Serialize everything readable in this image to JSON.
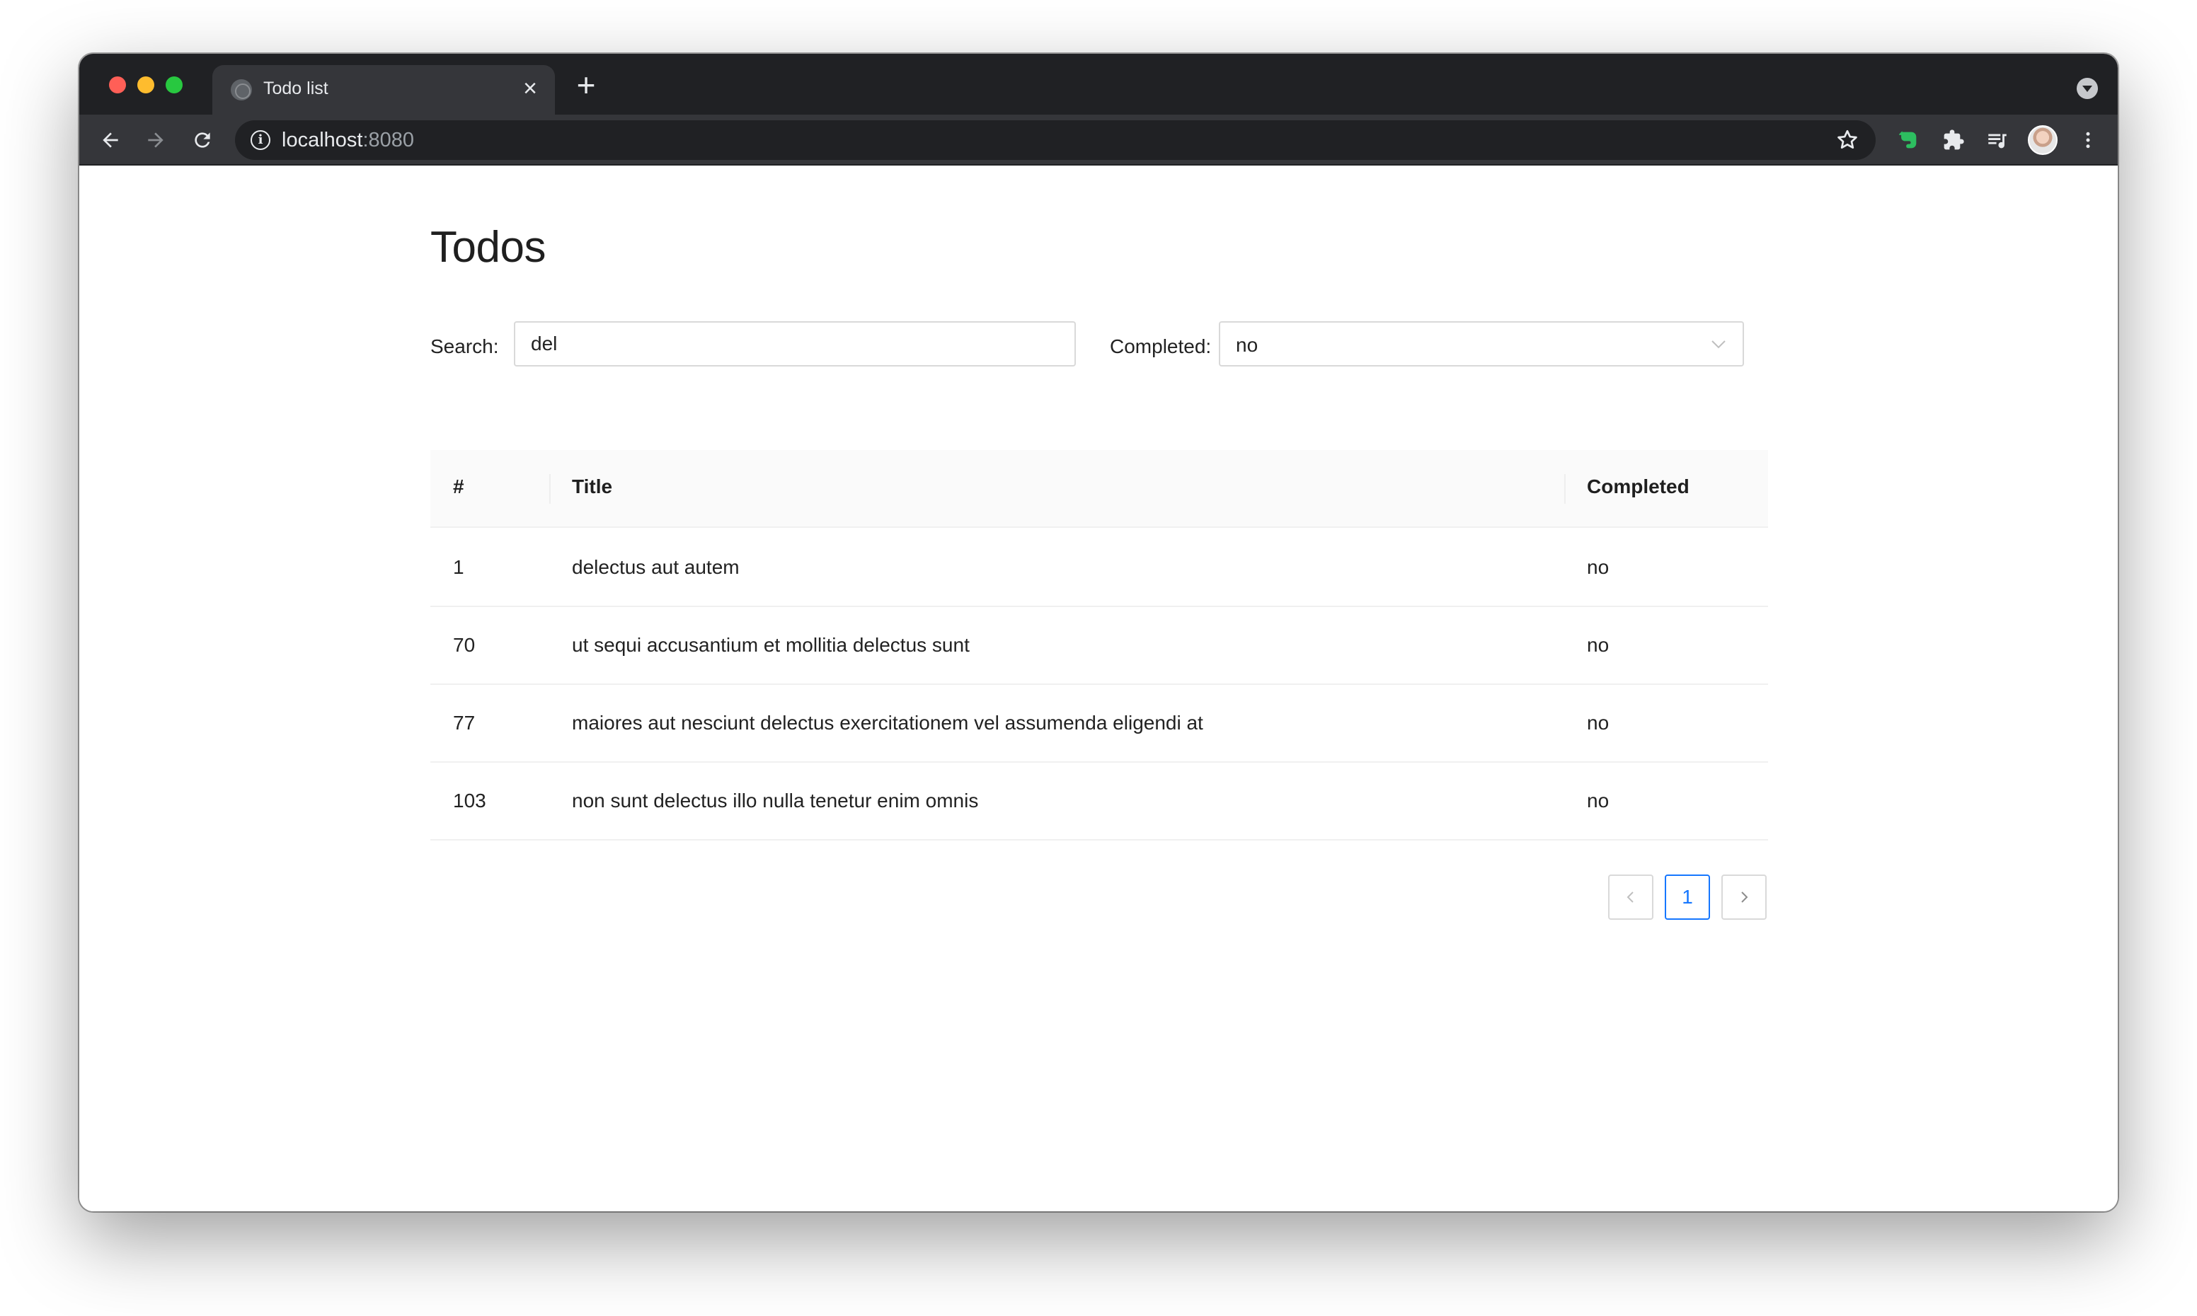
{
  "browser": {
    "tab_title": "Todo list",
    "tab_close": "×",
    "new_tab": "+",
    "url_host": "localhost",
    "url_port": ":8080",
    "icons": [
      "back-arrow-icon",
      "forward-arrow-icon",
      "reload-icon",
      "info-icon",
      "star-icon",
      "evernote-icon",
      "puzzle-icon",
      "media-control-icon",
      "profile-avatar",
      "kebab-menu-icon"
    ]
  },
  "page": {
    "title": "Todos"
  },
  "filters": {
    "search_label": "Search:",
    "search_value": "del",
    "completed_label": "Completed:",
    "completed_value": "no"
  },
  "table": {
    "columns": [
      "#",
      "Title",
      "Completed"
    ],
    "rows": [
      {
        "id": "1",
        "title": "delectus aut autem",
        "completed": "no"
      },
      {
        "id": "70",
        "title": "ut sequi accusantium et mollitia delectus sunt",
        "completed": "no"
      },
      {
        "id": "77",
        "title": "maiores aut nesciunt delectus exercitationem vel assumenda eligendi at",
        "completed": "no"
      },
      {
        "id": "103",
        "title": "non sunt delectus illo nulla tenetur enim omnis",
        "completed": "no"
      }
    ]
  },
  "pagination": {
    "current_page": "1"
  },
  "colors": {
    "accent": "#1677ff",
    "chrome_dark": "#202124",
    "chrome_toolbar": "#35363a"
  }
}
